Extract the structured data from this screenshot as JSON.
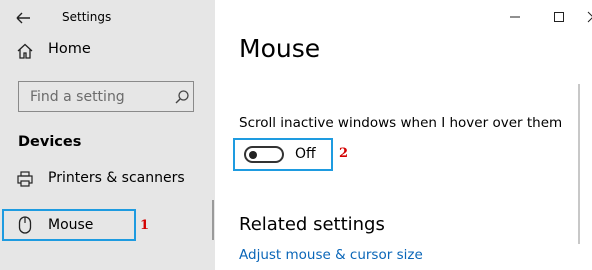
{
  "window": {
    "title": "Settings"
  },
  "sidebar": {
    "home_label": "Home",
    "search_placeholder": "Find a setting",
    "section_heading": "Devices",
    "items": [
      {
        "label": "Printers & scanners",
        "icon": "printer-icon"
      },
      {
        "label": "Mouse",
        "icon": "mouse-icon",
        "selected": true
      }
    ]
  },
  "main": {
    "title": "Mouse",
    "scroll_setting": {
      "label": "Scroll inactive windows when I hover over them",
      "state": "Off"
    },
    "related_heading": "Related settings",
    "links": [
      "Adjust mouse & cursor size"
    ]
  },
  "annotations": {
    "marker_1": "1",
    "marker_2": "2"
  },
  "colors": {
    "highlight": "#1e9be0",
    "marker": "#d40000",
    "link": "#0a66b8",
    "sidebar_bg": "#e6e6e6"
  }
}
